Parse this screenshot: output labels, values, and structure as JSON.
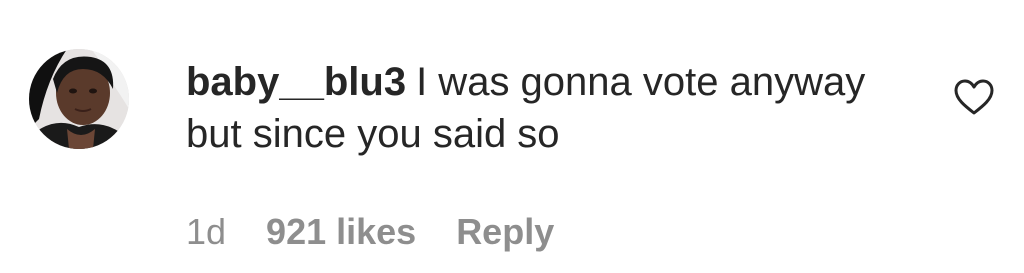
{
  "comment": {
    "username": "baby__blu3",
    "text": "I was gonna vote anyway but since you said so",
    "timestamp": "1d",
    "likes": "921 likes",
    "reply_label": "Reply",
    "like_icon": "heart-outline-icon",
    "avatar_icon": "user-avatar"
  }
}
